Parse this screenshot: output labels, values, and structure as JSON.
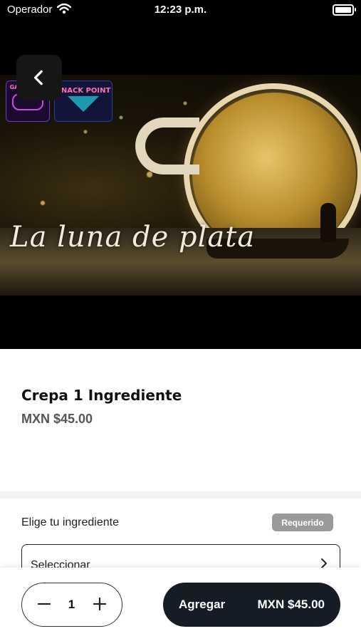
{
  "status_bar": {
    "carrier": "Operador",
    "time": "12:23 p.m.",
    "icons": [
      "wifi-icon",
      "battery-icon"
    ]
  },
  "hero": {
    "title_art": "La luna de plata",
    "logos": {
      "game": "GAME TIME",
      "snack": "SNACK POINT"
    }
  },
  "navigation": {
    "back_icon": "chevron-left-icon"
  },
  "product": {
    "name": "Crepa 1 Ingrediente",
    "price": "MXN $45.00"
  },
  "option_group": {
    "label": "Elige tu ingrediente",
    "badge": "Requerido",
    "select_text": "Seleccionar",
    "select_icon": "chevron-right-icon"
  },
  "cart": {
    "quantity": "1",
    "add_label": "Agregar",
    "add_price": "MXN $45.00",
    "accent_color": "#151c26"
  }
}
